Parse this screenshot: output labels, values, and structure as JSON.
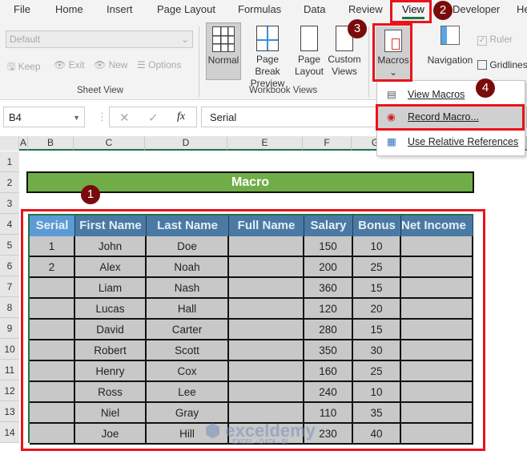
{
  "tabs": [
    "File",
    "Home",
    "Insert",
    "Page Layout",
    "Formulas",
    "Data",
    "Review",
    "View",
    "Developer",
    "He"
  ],
  "active_tab": "View",
  "ribbon": {
    "sheet_view": {
      "dropdown": "Default",
      "keep": "Keep",
      "exit": "Exit",
      "new": "New",
      "options": "Options",
      "group": "Sheet View"
    },
    "workbook_views": {
      "normal": "Normal",
      "page_break_1": "Page Break",
      "page_break_2": "Preview",
      "page_layout_1": "Page",
      "page_layout_2": "Layout",
      "custom_1": "Custom",
      "custom_2": "Views",
      "group": "Workbook Views"
    },
    "macros": "Macros",
    "navigation": "Navigation",
    "ruler": "Ruler",
    "gridlines": "Gridlines"
  },
  "macros_menu": {
    "view": "View Macros",
    "record": "Record Macro...",
    "relative": "Use Relative References"
  },
  "formula_bar": {
    "name_box": "B4",
    "fx": "fx",
    "value": "Serial"
  },
  "columns": [
    "A",
    "B",
    "C",
    "D",
    "E",
    "F",
    "G"
  ],
  "rows": [
    "1",
    "2",
    "3",
    "4",
    "5",
    "6",
    "7",
    "8",
    "9",
    "10",
    "11",
    "12",
    "13",
    "14"
  ],
  "title": "Macro",
  "table": {
    "headers": [
      "Serial",
      "First Name",
      "Last Name",
      "Full Name",
      "Salary",
      "Bonus",
      "Net Income"
    ],
    "rows": [
      [
        "1",
        "John",
        "Doe",
        "",
        "150",
        "10",
        ""
      ],
      [
        "2",
        "Alex",
        "Noah",
        "",
        "200",
        "25",
        ""
      ],
      [
        "",
        "Liam",
        "Nash",
        "",
        "360",
        "15",
        ""
      ],
      [
        "",
        "Lucas",
        "Hall",
        "",
        "120",
        "20",
        ""
      ],
      [
        "",
        "David",
        "Carter",
        "",
        "280",
        "15",
        ""
      ],
      [
        "",
        "Robert",
        "Scott",
        "",
        "350",
        "30",
        ""
      ],
      [
        "",
        "Henry",
        "Cox",
        "",
        "160",
        "25",
        ""
      ],
      [
        "",
        "Ross",
        "Lee",
        "",
        "240",
        "10",
        ""
      ],
      [
        "",
        "Niel",
        "Gray",
        "",
        "110",
        "35",
        ""
      ],
      [
        "",
        "Joe",
        "Hill",
        "",
        "230",
        "40",
        ""
      ]
    ]
  },
  "callouts": [
    "1",
    "2",
    "3",
    "4"
  ],
  "watermark": {
    "name": "exceldemy",
    "tag": "EXCEL · DATA · BI"
  },
  "colors": {
    "accent_green": "#217346",
    "title_fill": "#70ad47",
    "header_fill": "#4a7aa4",
    "callout_red": "#e8141b",
    "badge": "#7a0b0b"
  }
}
